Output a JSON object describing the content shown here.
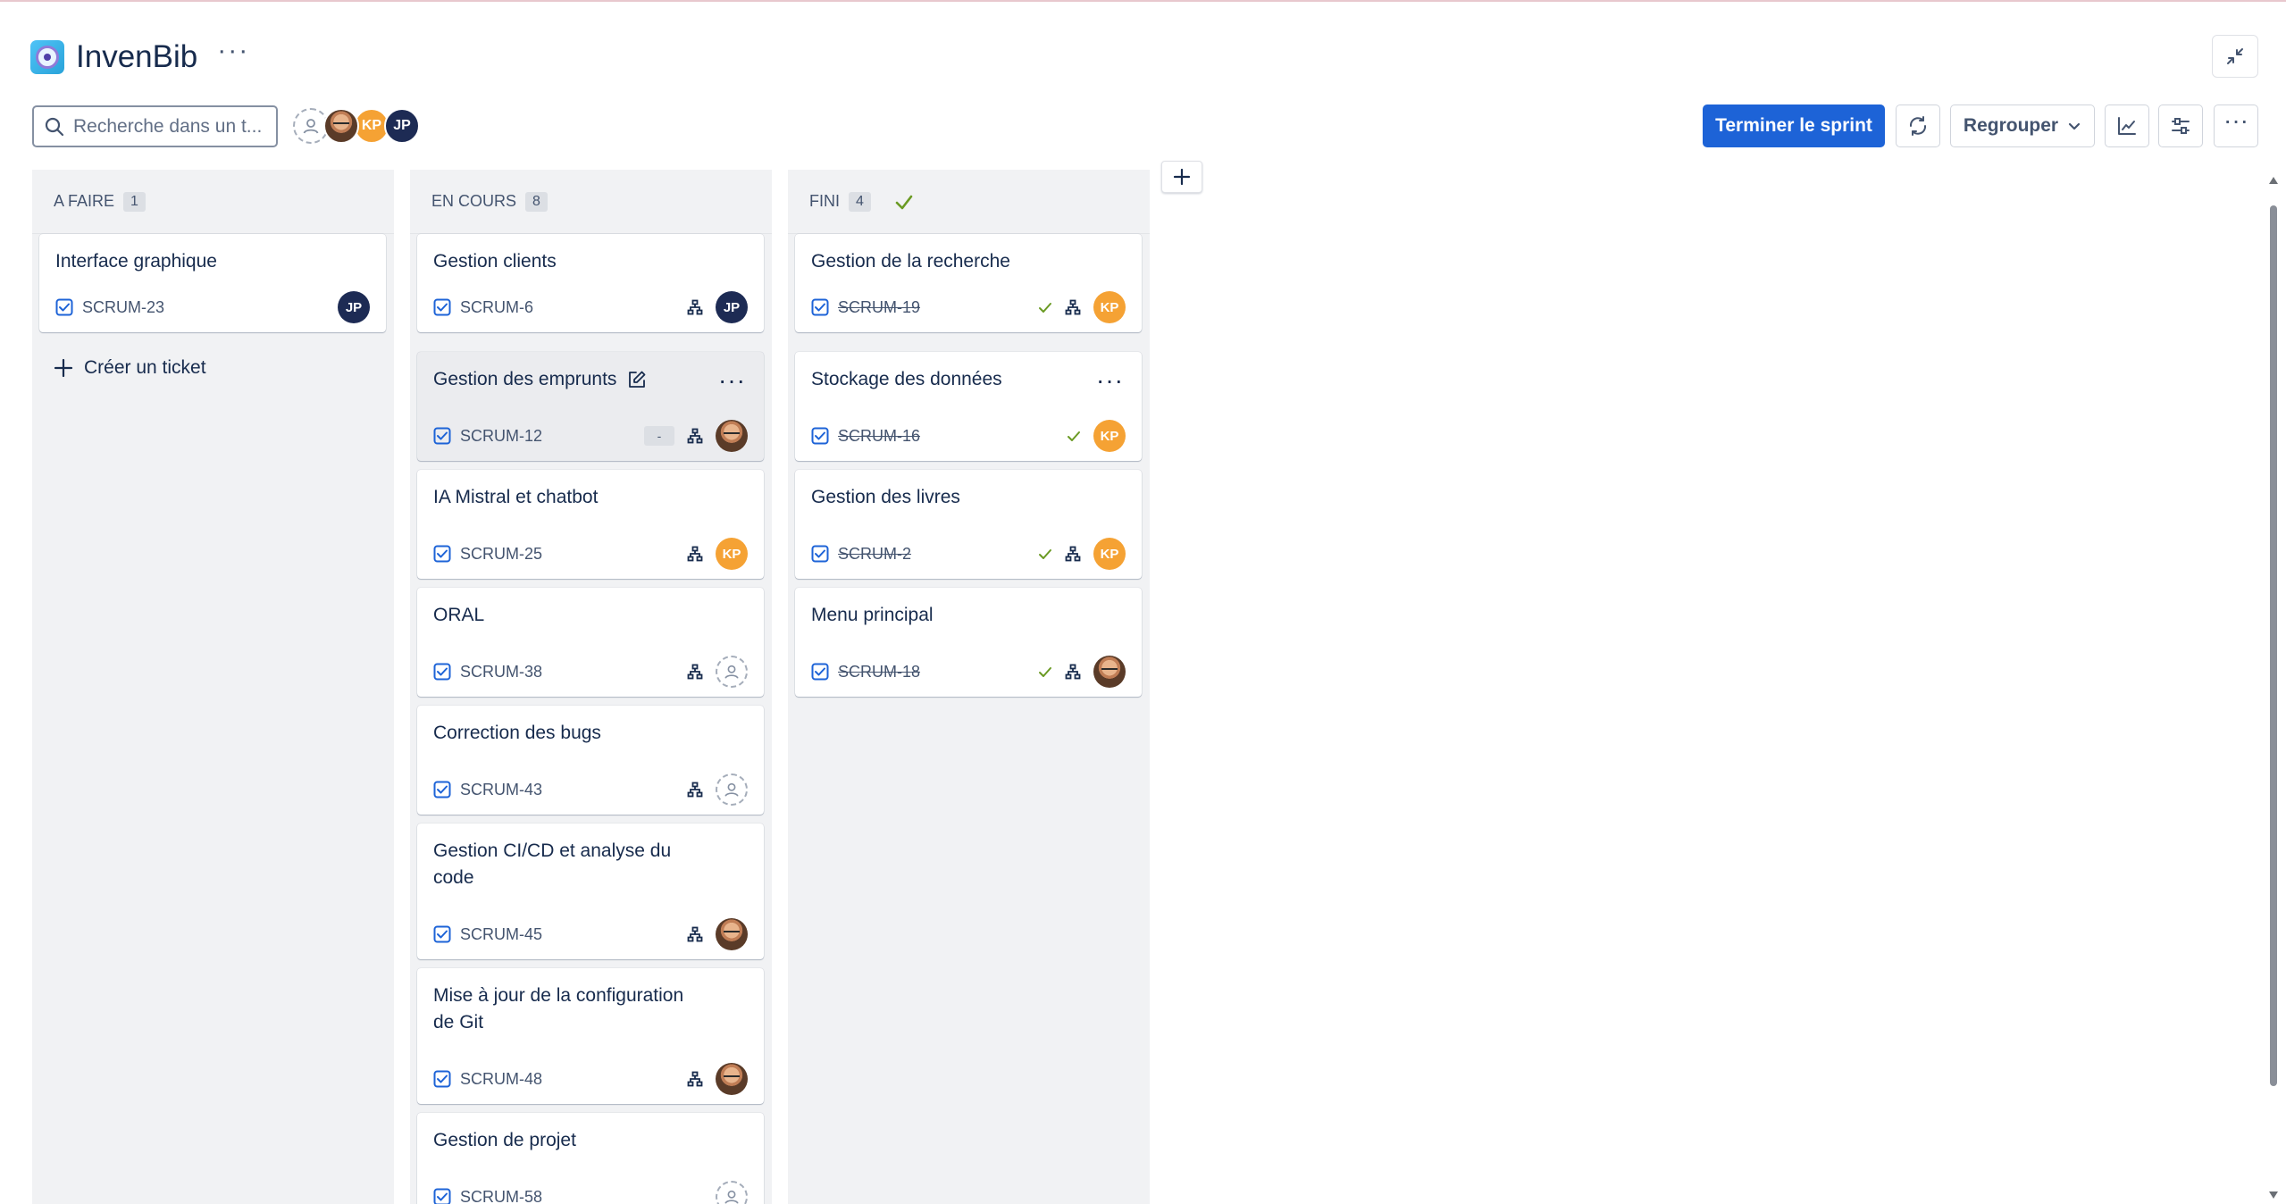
{
  "project": {
    "title": "InvenBib",
    "more": "···"
  },
  "search": {
    "placeholder": "Recherche dans un t..."
  },
  "toolbar": {
    "complete_sprint": "Terminer le sprint",
    "group_by": "Regrouper",
    "more": "···",
    "avatars": [
      "unassigned",
      "photo",
      "KP",
      "JP"
    ]
  },
  "columns": [
    {
      "name": "A FAIRE",
      "count": "1",
      "create_label": "Créer un ticket"
    },
    {
      "name": "EN COURS",
      "count": "8"
    },
    {
      "name": "FINI",
      "count": "4"
    }
  ],
  "todo_cards": [
    {
      "title": "Interface graphique",
      "key": "SCRUM-23",
      "assignee": "JP"
    }
  ],
  "progress_cards": [
    {
      "title": "Gestion clients",
      "key": "SCRUM-6",
      "assignee": "JP"
    },
    {
      "title": "Gestion des emprunts",
      "key": "SCRUM-12",
      "badge": "-",
      "assignee": "photo"
    },
    {
      "title": "IA Mistral et chatbot",
      "key": "SCRUM-25",
      "assignee": "KP"
    },
    {
      "title": "ORAL",
      "key": "SCRUM-38",
      "assignee": "unassigned"
    },
    {
      "title": "Correction des bugs",
      "key": "SCRUM-43",
      "assignee": "unassigned"
    },
    {
      "title": "Gestion CI/CD et analyse du code",
      "key": "SCRUM-45",
      "assignee": "photo"
    },
    {
      "title": "Mise à jour de la configuration de Git",
      "key": "SCRUM-48",
      "assignee": "photo"
    },
    {
      "title": "Gestion de projet",
      "key": "SCRUM-58",
      "assignee": "unassigned"
    }
  ],
  "done_cards": [
    {
      "title": "Gestion de la recherche",
      "key": "SCRUM-19",
      "assignee": "KP"
    },
    {
      "title": "Stockage des données",
      "key": "SCRUM-16",
      "assignee": "KP"
    },
    {
      "title": "Gestion des livres",
      "key": "SCRUM-2",
      "assignee": "KP"
    },
    {
      "title": "Menu principal",
      "key": "SCRUM-18",
      "assignee": "photo"
    }
  ],
  "colors": {
    "primary": "#1d63d7",
    "kp": "#f5a234",
    "jp": "#1d2b54",
    "done_check": "#6a9a23",
    "checkbox": "#1d63d7"
  }
}
